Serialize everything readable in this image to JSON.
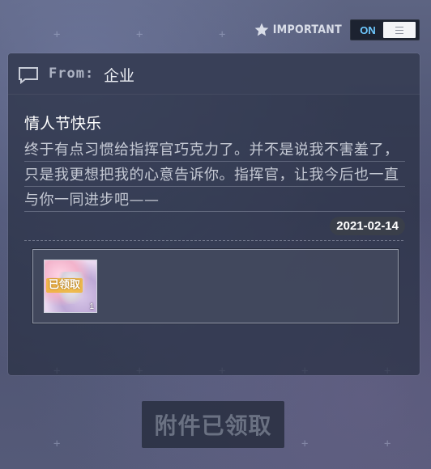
{
  "header": {
    "important_label": "IMPORTANT",
    "toggle_state": "ON"
  },
  "mail": {
    "from_label": "From:",
    "from_value": "企业",
    "title": "情人节快乐",
    "body": "终于有点习惯给指挥官巧克力了。并不是说我不害羞了，只是我更想把我的心意告诉你。指挥官，让我今后也一直与你一同进步吧——",
    "date": "2021-02-14"
  },
  "attachment": {
    "status_stamp": "已领取",
    "count": "1"
  },
  "footer": {
    "claim_button_label": "附件已领取"
  },
  "colors": {
    "toggle_on_text": "#6ec8ff",
    "claimed_stamp": "#f0b432",
    "date_badge_bg": "#3a3f4a"
  },
  "icons": [
    "star-icon",
    "mail-icon",
    "toggle-handle-icon"
  ]
}
